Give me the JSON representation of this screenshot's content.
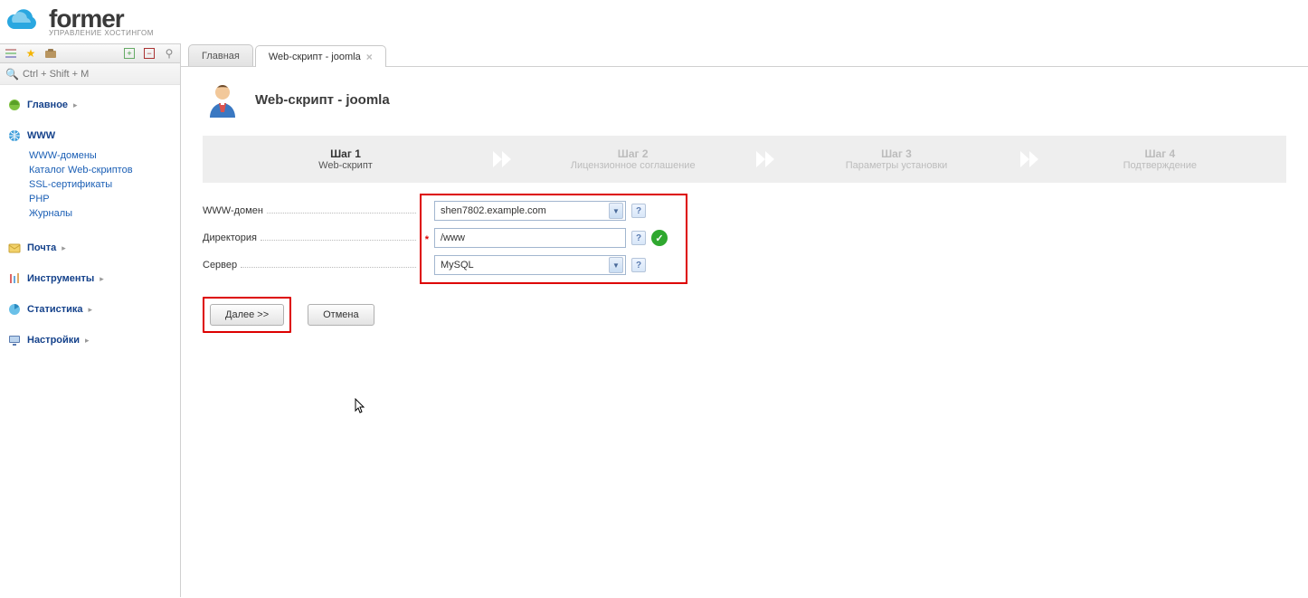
{
  "brand": {
    "name": "former",
    "tagline": "УПРАВЛЕНИЕ ХОСТИНГОМ"
  },
  "search": {
    "placeholder": "Ctrl + Shift + M"
  },
  "sidebar": {
    "main": "Главное",
    "www": "WWW",
    "www_items": [
      "WWW-домены",
      "Каталог Web-скриптов",
      "SSL-сертификаты",
      "PHP",
      "Журналы"
    ],
    "mail": "Почта",
    "tools": "Инструменты",
    "stats": "Статистика",
    "settings": "Настройки"
  },
  "tabs": [
    {
      "label": "Главная"
    },
    {
      "label": "Web-скрипт - joomla"
    }
  ],
  "page": {
    "title": "Web-скрипт - joomla"
  },
  "steps": [
    {
      "title": "Шаг 1",
      "sub": "Web-скрипт"
    },
    {
      "title": "Шаг 2",
      "sub": "Лицензионное соглашение"
    },
    {
      "title": "Шаг 3",
      "sub": "Параметры установки"
    },
    {
      "title": "Шаг 4",
      "sub": "Подтверждение"
    }
  ],
  "form": {
    "domain_label": "WWW-домен",
    "domain_value": "shen7802.example.com",
    "dir_label": "Директория",
    "dir_value": "/www",
    "server_label": "Сервер",
    "server_value": "MySQL"
  },
  "buttons": {
    "next": "Далее >>",
    "cancel": "Отмена"
  }
}
